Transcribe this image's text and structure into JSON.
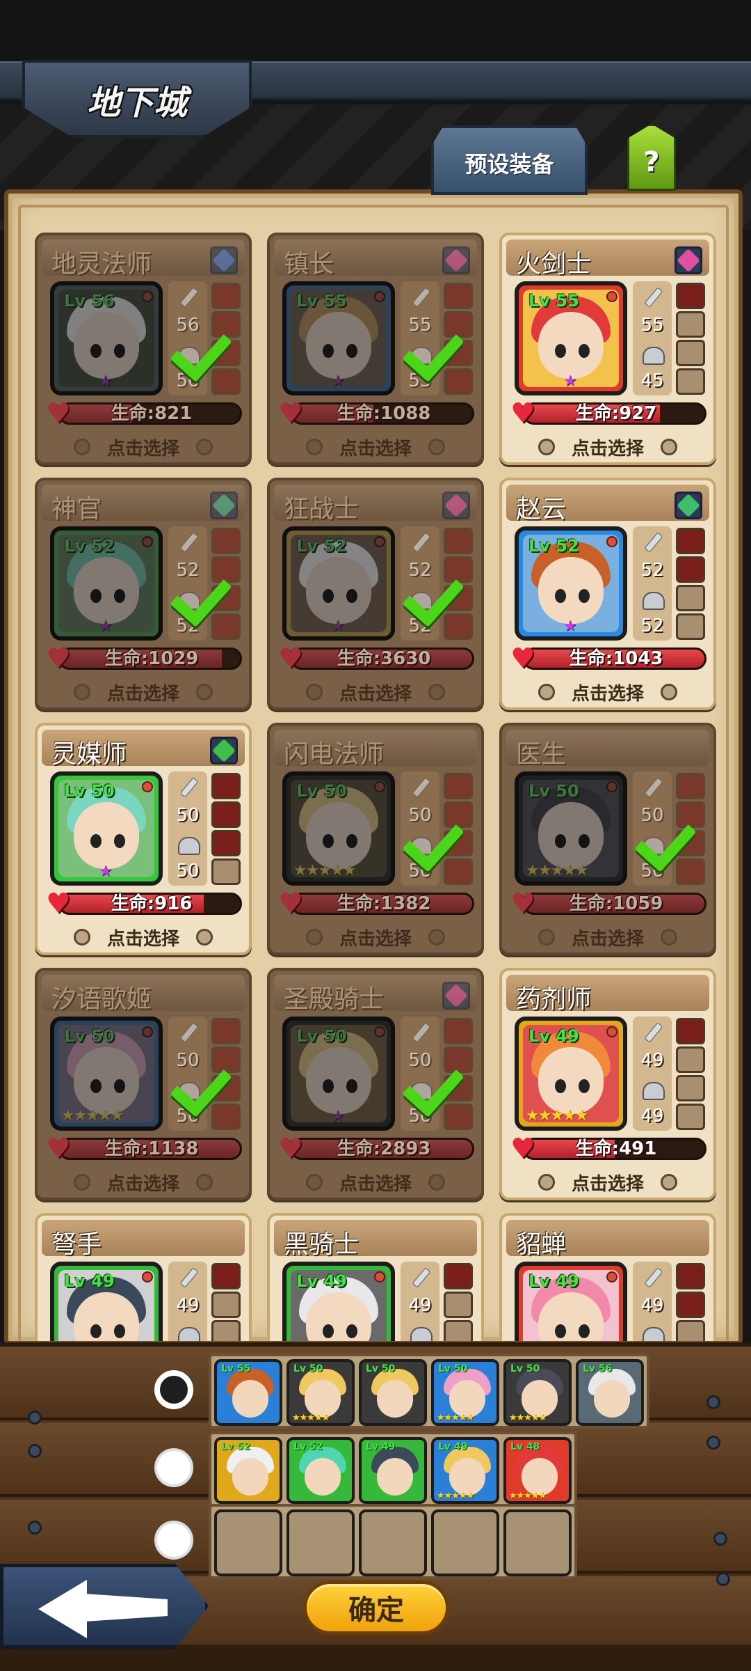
{
  "header": {
    "title": "地下城",
    "preset_label": "预设装备",
    "help_label": "?"
  },
  "labels": {
    "hp_prefix": "生命:",
    "select": "点击选择"
  },
  "cards": [
    {
      "name": "地灵法师",
      "level": "Lv 56",
      "atk": "56",
      "def": "56",
      "hp": "821",
      "hp_pct": 40,
      "selected": true,
      "active": false,
      "stars": 0,
      "gem": "#3f7cd6",
      "frame": "#5a6a74",
      "hair": "#e8e8ea",
      "bg": "#4a5a3e",
      "slots": [
        1,
        1,
        1,
        1
      ]
    },
    {
      "name": "镇长",
      "level": "Lv 55",
      "atk": "55",
      "def": "55",
      "hp": "1088",
      "hp_pct": 45,
      "selected": true,
      "active": false,
      "stars": 0,
      "gem": "#e04fa0",
      "frame": "#2a7fd6",
      "hair": "#d99a3c",
      "bg": "#7d6a50",
      "slots": [
        1,
        1,
        1,
        1
      ]
    },
    {
      "name": "火剑士",
      "level": "Lv 55",
      "atk": "55",
      "def": "45",
      "hp": "927",
      "hp_pct": 75,
      "selected": false,
      "active": true,
      "stars": 0,
      "gem": "#e04fa0",
      "frame": "#e03a2a",
      "hair": "#e03a3a",
      "bg": "#f2c24a",
      "slots": [
        1,
        0,
        0,
        0
      ]
    },
    {
      "name": "神官",
      "level": "Lv 52",
      "atk": "52",
      "def": "52",
      "hp": "1029",
      "hp_pct": 90,
      "selected": true,
      "active": false,
      "stars": 0,
      "gem": "#3fbf9a",
      "frame": "#36b83a",
      "hair": "#4fd6b0",
      "bg": "#5a8a5a",
      "slots": [
        1,
        1,
        1,
        1
      ]
    },
    {
      "name": "狂战士",
      "level": "Lv 52",
      "atk": "52",
      "def": "52",
      "hp": "3630",
      "hp_pct": 100,
      "selected": true,
      "active": false,
      "stars": 0,
      "gem": "#e04fa0",
      "frame": "#e0a81a",
      "hair": "#f0f0f0",
      "bg": "#8a6a4a",
      "slots": [
        1,
        1,
        1,
        1
      ]
    },
    {
      "name": "赵云",
      "level": "Lv 52",
      "atk": "52",
      "def": "52",
      "hp": "1043",
      "hp_pct": 100,
      "selected": false,
      "active": true,
      "stars": 0,
      "gem": "#3fbf6a",
      "frame": "#2a8ae0",
      "hair": "#c8602a",
      "bg": "#7ab0e0",
      "slots": [
        1,
        1,
        0,
        0
      ]
    },
    {
      "name": "灵媒师",
      "level": "Lv 50",
      "atk": "50",
      "def": "50",
      "hp": "916",
      "hp_pct": 80,
      "selected": false,
      "active": true,
      "stars": 0,
      "gem": "#3fbf4a",
      "frame": "#36c83a",
      "hair": "#7ad6c0",
      "bg": "#7ac07a",
      "slots": [
        1,
        1,
        1,
        0
      ]
    },
    {
      "name": "闪电法师",
      "level": "Lv 50",
      "atk": "50",
      "def": "50",
      "hp": "1382",
      "hp_pct": 100,
      "selected": true,
      "active": false,
      "stars": 5,
      "gem": "",
      "frame": "#3a3a3a",
      "hair": "#f0c860",
      "bg": "#6a5a3a",
      "slots": [
        1,
        1,
        1,
        1
      ]
    },
    {
      "name": "医生",
      "level": "Lv 50",
      "atk": "50",
      "def": "50",
      "hp": "1059",
      "hp_pct": 100,
      "selected": true,
      "active": false,
      "stars": 5,
      "gem": "",
      "frame": "#3a3a3a",
      "hair": "#4a4a5a",
      "bg": "#5a5a6a",
      "slots": [
        1,
        1,
        1,
        1
      ]
    },
    {
      "name": "汐语歌姬",
      "level": "Lv 50",
      "atk": "50",
      "def": "50",
      "hp": "1138",
      "hp_pct": 100,
      "selected": true,
      "active": false,
      "stars": 5,
      "gem": "",
      "frame": "#2a7fd6",
      "hair": "#f0a0c8",
      "bg": "#8a7aa0",
      "slots": [
        1,
        1,
        1,
        1
      ]
    },
    {
      "name": "圣殿骑士",
      "level": "Lv 50",
      "atk": "50",
      "def": "50",
      "hp": "2893",
      "hp_pct": 100,
      "selected": true,
      "active": false,
      "stars": 0,
      "gem": "#e04fa0",
      "frame": "#3a3a3a",
      "hair": "#f0c860",
      "bg": "#8a6a3a",
      "slots": [
        1,
        1,
        1,
        1
      ]
    },
    {
      "name": "药剂师",
      "level": "Lv 49",
      "atk": "49",
      "def": "49",
      "hp": "491",
      "hp_pct": 50,
      "selected": false,
      "active": true,
      "stars": 5,
      "gem": "",
      "frame": "#e0a81a",
      "hair": "#f08a3a",
      "bg": "#e05050",
      "slots": [
        1,
        0,
        0,
        0
      ]
    },
    {
      "name": "弩手",
      "level": "Lv 49",
      "atk": "49",
      "def": "",
      "hp": "",
      "hp_pct": 0,
      "selected": false,
      "active": true,
      "stars": 0,
      "gem": "",
      "frame": "#36b83a",
      "hair": "#3a4a5a",
      "bg": "#d0d0d0",
      "slots": [
        1,
        0,
        0,
        0
      ]
    },
    {
      "name": "黑骑士",
      "level": "Lv 49",
      "atk": "49",
      "def": "",
      "hp": "",
      "hp_pct": 0,
      "selected": false,
      "active": true,
      "stars": 0,
      "gem": "",
      "frame": "#36b83a",
      "hair": "#e8e8ea",
      "bg": "#6a6a6a",
      "slots": [
        1,
        0,
        0,
        0
      ]
    },
    {
      "name": "貂蝉",
      "level": "Lv 49",
      "atk": "49",
      "def": "",
      "hp": "",
      "hp_pct": 0,
      "selected": false,
      "active": true,
      "stars": 0,
      "gem": "",
      "frame": "#e03a2a",
      "hair": "#f08aa8",
      "bg": "#f2c2d0",
      "slots": [
        1,
        1,
        0,
        0
      ]
    }
  ],
  "teams": [
    {
      "selected": true,
      "members": [
        {
          "level": "Lv 55",
          "hair": "#c8602a",
          "frame": "#2a7fd6",
          "stars": 0
        },
        {
          "level": "Lv 50",
          "hair": "#f0c860",
          "frame": "#3a3a3a",
          "stars": 5
        },
        {
          "level": "Lv 50",
          "hair": "#f0c860",
          "frame": "#3a3a3a",
          "stars": 0
        },
        {
          "level": "Lv 50",
          "hair": "#f0a0c8",
          "frame": "#2a7fd6",
          "stars": 5
        },
        {
          "level": "Lv 50",
          "hair": "#4a4a5a",
          "frame": "#3a3a3a",
          "stars": 5
        },
        {
          "level": "Lv 56",
          "hair": "#e8e8ea",
          "frame": "#5a6a74",
          "stars": 0
        }
      ]
    },
    {
      "selected": false,
      "members": [
        {
          "level": "Lv 52",
          "hair": "#f0f0f0",
          "frame": "#e0a81a",
          "stars": 0
        },
        {
          "level": "Lv 52",
          "hair": "#4fd6b0",
          "frame": "#36b83a",
          "stars": 0
        },
        {
          "level": "Lv 49",
          "hair": "#3a4a5a",
          "frame": "#36b83a",
          "stars": 0
        },
        {
          "level": "Lv 49",
          "hair": "#f0c860",
          "frame": "#2a7fd6",
          "stars": 5
        },
        {
          "level": "Lv 48",
          "hair": "#e03a3a",
          "frame": "#e03a2a",
          "stars": 5
        }
      ]
    },
    {
      "selected": false,
      "members": []
    }
  ],
  "footer": {
    "confirm_label": "确定"
  }
}
